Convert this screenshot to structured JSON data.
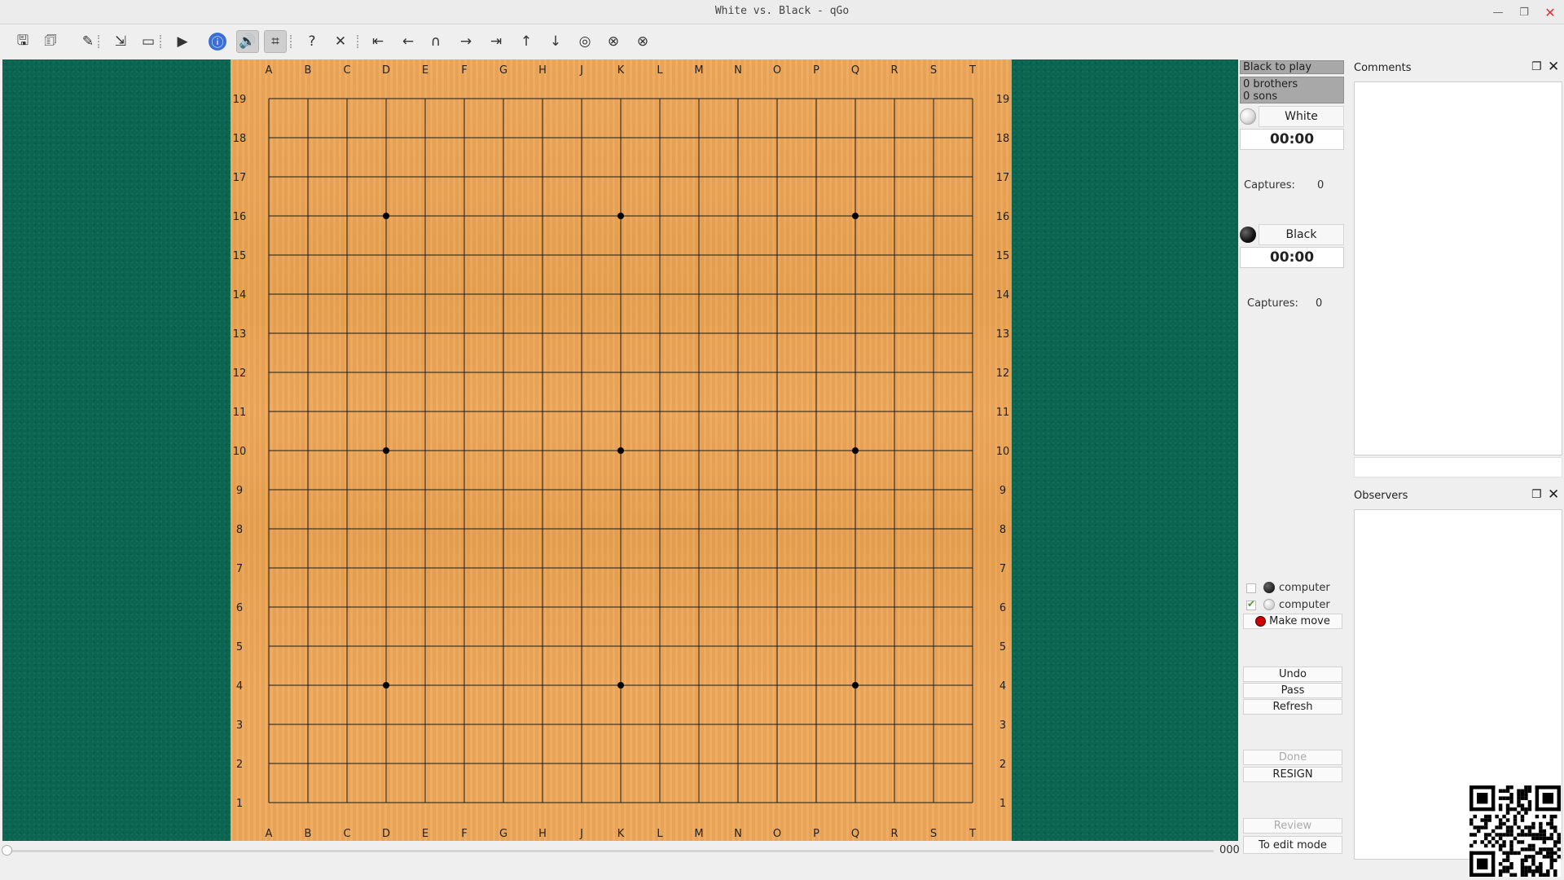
{
  "window": {
    "title": "White vs. Black - qGo"
  },
  "toolbar": {
    "buttons": [
      {
        "name": "save-icon",
        "glyph": "🖫"
      },
      {
        "name": "save-as-icon",
        "glyph": "🗊"
      },
      {
        "name": "board-color-icon",
        "glyph": "✎"
      },
      {
        "name": "export-icon",
        "glyph": "⇲"
      },
      {
        "name": "window-icon",
        "glyph": "▭"
      },
      {
        "name": "play-icon",
        "glyph": "▶"
      },
      {
        "name": "info-icon",
        "glyph": "ⓘ"
      },
      {
        "name": "sound-icon",
        "glyph": "🔊"
      },
      {
        "name": "coordinates-icon",
        "glyph": "⌗"
      },
      {
        "name": "help-icon",
        "glyph": "?"
      },
      {
        "name": "close-x-icon",
        "glyph": "✕"
      },
      {
        "name": "first-move-icon",
        "glyph": "⇤"
      },
      {
        "name": "previous-move-icon",
        "glyph": "←"
      },
      {
        "name": "previous-branch-icon",
        "glyph": "∩"
      },
      {
        "name": "next-move-icon",
        "glyph": "→"
      },
      {
        "name": "last-move-icon",
        "glyph": "⇥"
      },
      {
        "name": "up-variation-icon",
        "glyph": "↑"
      },
      {
        "name": "down-variation-icon",
        "glyph": "↓"
      },
      {
        "name": "main-branch-icon",
        "glyph": "◎"
      },
      {
        "name": "start-variation-icon",
        "glyph": "⊗"
      },
      {
        "name": "end-variation-icon",
        "glyph": "⊗"
      }
    ]
  },
  "board": {
    "size": 19,
    "columns": [
      "A",
      "B",
      "C",
      "D",
      "E",
      "F",
      "G",
      "H",
      "J",
      "K",
      "L",
      "M",
      "N",
      "O",
      "P",
      "Q",
      "R",
      "S",
      "T"
    ],
    "rows": [
      "19",
      "18",
      "17",
      "16",
      "15",
      "14",
      "13",
      "12",
      "11",
      "10",
      "9",
      "8",
      "7",
      "6",
      "5",
      "4",
      "3",
      "2",
      "1"
    ],
    "hoshi": [
      [
        3,
        3
      ],
      [
        3,
        9
      ],
      [
        3,
        15
      ],
      [
        9,
        3
      ],
      [
        9,
        9
      ],
      [
        9,
        15
      ],
      [
        15,
        3
      ],
      [
        15,
        9
      ],
      [
        15,
        15
      ]
    ],
    "background_color": "#eea85a",
    "line_color": "#1a1a1a"
  },
  "side_panel": {
    "to_play": "Black to play",
    "brothers": "0 brothers",
    "sons": "0 sons",
    "white": {
      "name": "White",
      "time": "00:00",
      "captures_label": "Captures:",
      "captures": "0"
    },
    "black": {
      "name": "Black",
      "time": "00:00",
      "captures_label": "Captures:",
      "captures": "0"
    },
    "computer_black": {
      "label": "computer",
      "checked": false
    },
    "computer_white": {
      "label": "computer",
      "checked": true
    },
    "make_move": "Make move",
    "undo": "Undo",
    "pass": "Pass",
    "refresh": "Refresh",
    "done": "Done",
    "resign": "RESIGN",
    "review": "Review",
    "edit_mode": "To edit mode"
  },
  "comments": {
    "title": "Comments"
  },
  "observers": {
    "title": "Observers"
  },
  "slider": {
    "move_number": "000"
  },
  "colors": {
    "felt": "#0b6551",
    "status_bg": "#a8a8a8"
  }
}
